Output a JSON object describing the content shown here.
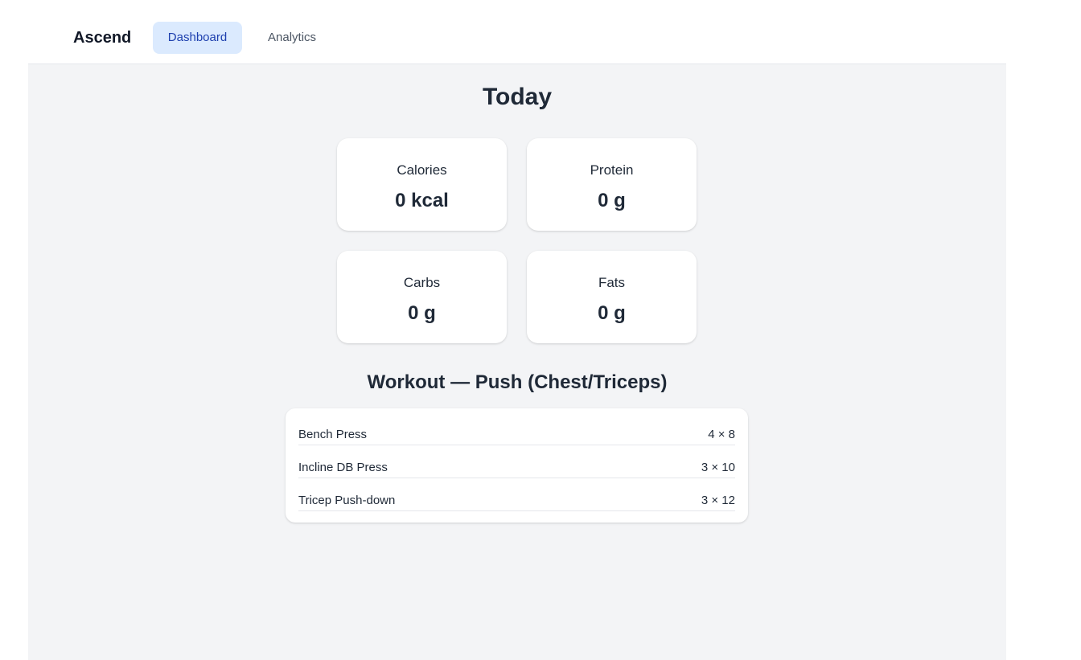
{
  "header": {
    "brand": "Ascend",
    "tabs": [
      {
        "label": "Dashboard",
        "active": true
      },
      {
        "label": "Analytics",
        "active": false
      }
    ]
  },
  "main": {
    "title": "Today",
    "stats": [
      {
        "label": "Calories",
        "value": "0 kcal"
      },
      {
        "label": "Protein",
        "value": "0 g"
      },
      {
        "label": "Carbs",
        "value": "0 g"
      },
      {
        "label": "Fats",
        "value": "0 g"
      }
    ],
    "workout": {
      "title": "Workout — Push (Chest/Triceps)",
      "exercises": [
        {
          "name": "Bench Press",
          "sets": "4 × 8"
        },
        {
          "name": "Incline DB Press",
          "sets": "3 × 10"
        },
        {
          "name": "Tricep Push-down",
          "sets": "3 × 12"
        }
      ]
    }
  },
  "colors": {
    "accent_bg": "#dbeafe",
    "accent_text": "#1e40af",
    "page_bg": "#f3f4f6"
  }
}
